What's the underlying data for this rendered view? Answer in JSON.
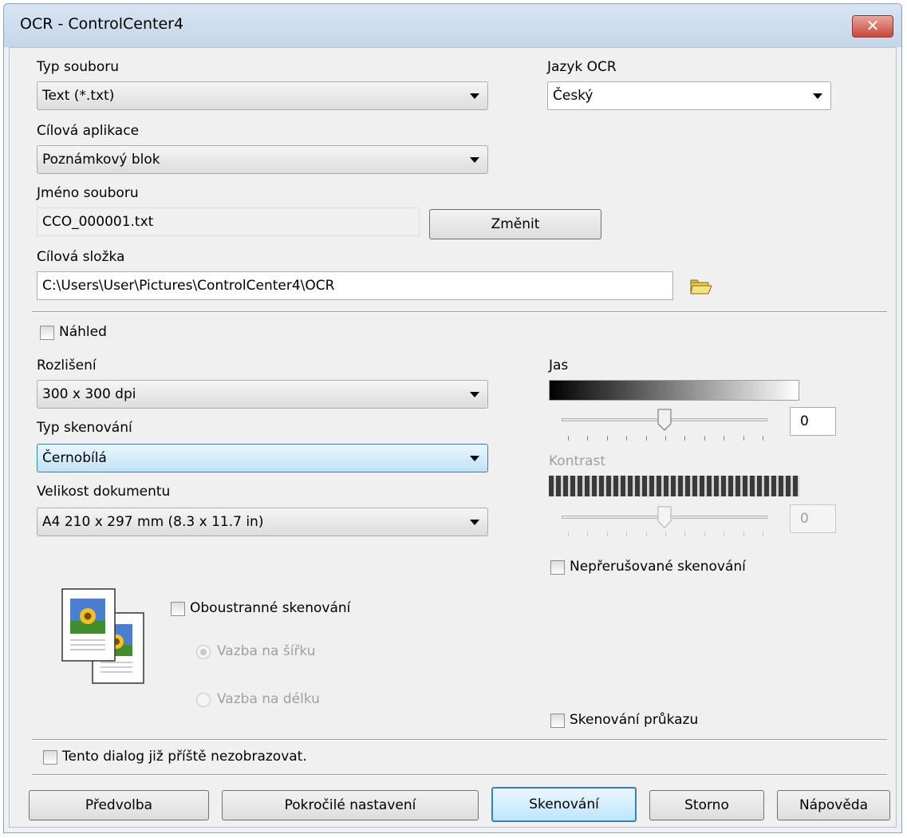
{
  "window": {
    "title": "OCR - ControlCenter4",
    "close_glyph": "✕"
  },
  "file_type": {
    "label": "Typ souboru",
    "value": "Text (*.txt)"
  },
  "ocr_language": {
    "label": "Jazyk OCR",
    "value": "Český"
  },
  "target_app": {
    "label": "Cílová aplikace",
    "value": "Poznámkový blok"
  },
  "file_name": {
    "label": "Jméno souboru",
    "value": "CCO_000001.txt",
    "change_button": "Změnit"
  },
  "target_folder": {
    "label": "Cílová složka",
    "value": "C:\\Users\\User\\Pictures\\ControlCenter4\\OCR",
    "browse_icon": "folder-icon"
  },
  "preview": {
    "label": "Náhled",
    "checked": false
  },
  "resolution": {
    "label": "Rozlišení",
    "value": "300 x 300 dpi"
  },
  "scan_type": {
    "label": "Typ skenování",
    "value": "Černobílá"
  },
  "document_size": {
    "label": "Velikost dokumentu",
    "value": "A4 210 x 297 mm (8.3 x 11.7 in)"
  },
  "brightness": {
    "label": "Jas",
    "value": "0",
    "slider_fraction": 0.5
  },
  "contrast": {
    "label": "Kontrast",
    "value": "0",
    "slider_fraction": 0.5,
    "enabled": false
  },
  "continuous_scan": {
    "label": "Nepřerušované skenování",
    "checked": false
  },
  "duplex": {
    "label": "Oboustranné skenování",
    "checked": false,
    "long_edge": {
      "label": "Vazba na šířku",
      "selected": true
    },
    "short_edge": {
      "label": "Vazba na délku",
      "selected": false
    }
  },
  "id_card_scan": {
    "label": "Skenování průkazu",
    "checked": false
  },
  "dont_show_again": {
    "label": "Tento dialog již příště nezobrazovat.",
    "checked": false
  },
  "buttons": {
    "preset": "Předvolba",
    "advanced": "Pokročilé nastavení",
    "scan": "Skenování",
    "cancel": "Storno",
    "help": "Nápověda"
  },
  "colors": {
    "accent": "#3c7fb1",
    "close": "#c9483a"
  }
}
